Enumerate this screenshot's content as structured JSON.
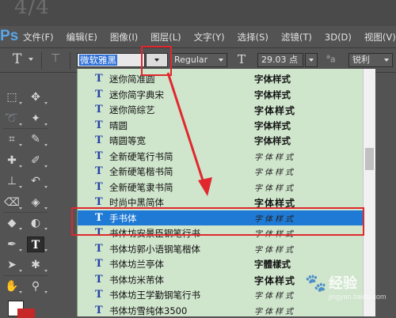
{
  "ghost_text": "4/4",
  "app": {
    "logo": "Ps"
  },
  "menubar": {
    "items": [
      "文件(F)",
      "编辑(E)",
      "图像(I)",
      "图层(L)",
      "文字(Y)",
      "选择(S)",
      "滤镜(T)",
      "3D(D)",
      "视图(V)"
    ]
  },
  "options": {
    "tool_glyph": "T",
    "font_family": "微软雅黑",
    "font_style": "Regular",
    "font_size": "29.03 点",
    "size_glyph": "T",
    "aa_glyph": "a",
    "aa_sub": "a",
    "antialias": "锐利"
  },
  "fontlist": {
    "rows": [
      {
        "name": "迷你简准圆",
        "sample": "字体样式",
        "style": "bold"
      },
      {
        "name": "迷你简字典宋",
        "sample": "字体样式",
        "style": "bold"
      },
      {
        "name": "迷你简综艺",
        "sample": "字体样式",
        "style": "heavy"
      },
      {
        "name": "晴圆",
        "sample": "字体样式",
        "style": "bold"
      },
      {
        "name": "晴圆等宽",
        "sample": "字体样式",
        "style": "mono"
      },
      {
        "name": "全新硬笔行书简",
        "sample": "字体样式",
        "style": "script"
      },
      {
        "name": "全新硬笔楷书简",
        "sample": "字体样式",
        "style": "script"
      },
      {
        "name": "全新硬笔隶书简",
        "sample": "字体样式",
        "style": "script"
      },
      {
        "name": "时尚中黑简体",
        "sample": "字体样式",
        "style": "heavy"
      },
      {
        "name": "手书体",
        "sample": "字体样式",
        "style": "script"
      },
      {
        "name": "书体坊安景臣钢笔行书",
        "sample": "字体样式",
        "style": "script"
      },
      {
        "name": "书体坊郭小语钢笔楷体",
        "sample": "字体样式",
        "style": "script"
      },
      {
        "name": "书体坊兰亭体",
        "sample": "字體樣式",
        "style": "bold"
      },
      {
        "name": "书体坊米芾体",
        "sample": "字体样式",
        "style": "heavy"
      },
      {
        "name": "书体坊王学勤钢笔行书",
        "sample": "字体样式",
        "style": "script"
      },
      {
        "name": "书体坊雪纯体3500",
        "sample": "字体样式",
        "style": "script"
      }
    ],
    "selected_index": 9,
    "icon_glyph": "T"
  },
  "watermark": {
    "brand": "经验",
    "url": "jingyan.baidu.com"
  },
  "colors": {
    "list_bg": "#cfe5cc",
    "selected_bg": "#1f7ad6",
    "highlight_red": "#e0282e",
    "fg_swatch": "#ffffff",
    "bg_swatch": "#c62828"
  },
  "icons": {
    "toolbox": [
      "marquee-icon",
      "move-icon",
      "lasso-icon",
      "magic-wand-icon",
      "crop-icon",
      "eyedropper-icon",
      "healing-brush-icon",
      "brush-icon",
      "clone-stamp-icon",
      "history-brush-icon",
      "eraser-icon",
      "paint-bucket-icon",
      "blur-icon",
      "dodge-icon",
      "pen-icon",
      "type-tool-icon",
      "path-select-icon",
      "custom-shape-icon",
      "hand-icon",
      "zoom-icon"
    ]
  }
}
